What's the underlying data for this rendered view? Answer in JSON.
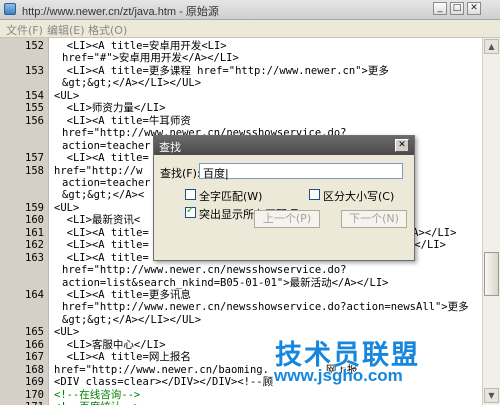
{
  "window": {
    "title": "http://www.newer.cn/zt/java.htm - 原始源",
    "controls": [
      "_",
      "□",
      "✕"
    ]
  },
  "menu": [
    "文件(F)",
    "编辑(E)",
    "格式(O)"
  ],
  "code_lines": [
    {
      "ln": "152",
      "text": "  <LI><A title=安卓用开发<LI>"
    },
    {
      "ln": "",
      "text": "href=\"#\">安卓用用开发</A></LI>"
    },
    {
      "ln": "153",
      "text": "  <LI><A title=更多课程 href=\"http://www.newer.cn\">更多"
    },
    {
      "ln": "",
      "text": "&gt;&gt;</A></LI></UL>"
    },
    {
      "ln": "154",
      "text": "<UL>"
    },
    {
      "ln": "155",
      "text": "  <LI>师资力量</LI>"
    },
    {
      "ln": "156",
      "text": "  <LI><A title=牛耳师资"
    },
    {
      "ln": "",
      "text": "href=\"http://www.newer.cn/newsshowservice.do?"
    },
    {
      "ln": "",
      "text": "action=teacher"
    },
    {
      "ln": "157",
      "text": "  <LI><A title="
    },
    {
      "ln": "158",
      "text": "href=\"http://w"
    },
    {
      "ln": "",
      "text": "action=teacher"
    },
    {
      "ln": "",
      "text": "&gt;&gt;</A><"
    },
    {
      "ln": "159",
      "text": "<UL>"
    },
    {
      "ln": "160",
      "text": "  <LI>最新资讯<"
    },
    {
      "ln": "161",
      "text": "  <LI><A title=                                      息</A></LI>"
    },
    {
      "ln": "162",
      "text": "  <LI><A title=                                      </A></LI>"
    },
    {
      "ln": "163",
      "text": "  <LI><A title="
    },
    {
      "ln": "",
      "text": "href=\"http://www.newer.cn/newsshowservice.do?"
    },
    {
      "ln": "",
      "text": "action=list&search_nkind=B05-01-01\">最新活动</A></LI>"
    },
    {
      "ln": "164",
      "text": "  <LI><A title=更多讯息"
    },
    {
      "ln": "",
      "text": "href=\"http://www.newer.cn/newsshowservice.do?action=newsAll\">更多"
    },
    {
      "ln": "",
      "text": "&gt;&gt;</A></LI></UL>"
    },
    {
      "ln": "165",
      "text": "<UL>"
    },
    {
      "ln": "166",
      "text": "  <LI>客服中心</LI>"
    },
    {
      "ln": "167",
      "text": "  <LI><A title=网上报名"
    },
    {
      "ln": "168",
      "text": "href=\"http://www.newer.cn/baoming.         网上报"
    },
    {
      "ln": "169",
      "text": "<DIV class=clear></DIV></DIV><!--顾"
    },
    {
      "ln": "170",
      "text": "<!--在线咨询-->"
    },
    {
      "ln": "171",
      "text": "<!--百度统计-->"
    }
  ],
  "find_dialog": {
    "title": "查找",
    "close": "✕",
    "find_label": "查找(F):",
    "find_value": "百度|",
    "options": [
      {
        "label": "全字匹配(W)",
        "checked": false
      },
      {
        "label": "区分大小写(C)",
        "checked": false
      },
      {
        "label": "突出显示所有匹配项(H)",
        "checked": true
      }
    ],
    "prev_button": "上一个(P)",
    "next_button": "下一个(N)"
  },
  "watermark": {
    "brand": "技术员联盟",
    "url": "www.jsgho.com"
  }
}
